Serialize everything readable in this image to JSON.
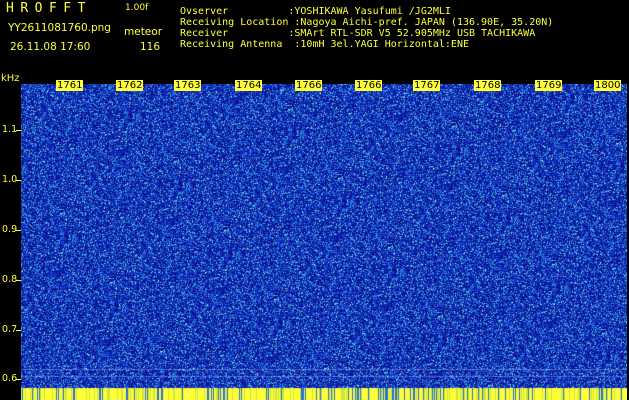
{
  "header": {
    "title": "HROFFT",
    "version": "1.00f",
    "filename": "YY2611081760.png",
    "mode": "meteor",
    "datetime": "26.11.08 17:60",
    "count": "116"
  },
  "station": [
    "Ovserver          :YOSHIKAWA Yasufumi /JG2MLI",
    "Receiving Location :Nagoya Aichi-pref. JAPAN (136.90E, 35.20N)",
    "Receiver          :SMArt RTL-SDR V5 52.905MHz USB TACHIKAWA",
    "Receiving Antenna  :10mH 3el.YAGI Horizontal:ENE"
  ],
  "y_axis": {
    "unit": "kHz",
    "labels": [
      "1.1",
      "1.0",
      "0.9",
      "0.8",
      "0.7",
      "0.6"
    ]
  },
  "time_labels": [
    "1761",
    "1762",
    "1763",
    "1764",
    "1766",
    "1766",
    "1767",
    "1768",
    "1769",
    "1800"
  ],
  "colors": {
    "text": "#ffff3a",
    "background": "#000000",
    "noise_base": "#0a1a9e",
    "noise_mid": "#1e6ad8",
    "noise_high": "#3fd0e8"
  }
}
